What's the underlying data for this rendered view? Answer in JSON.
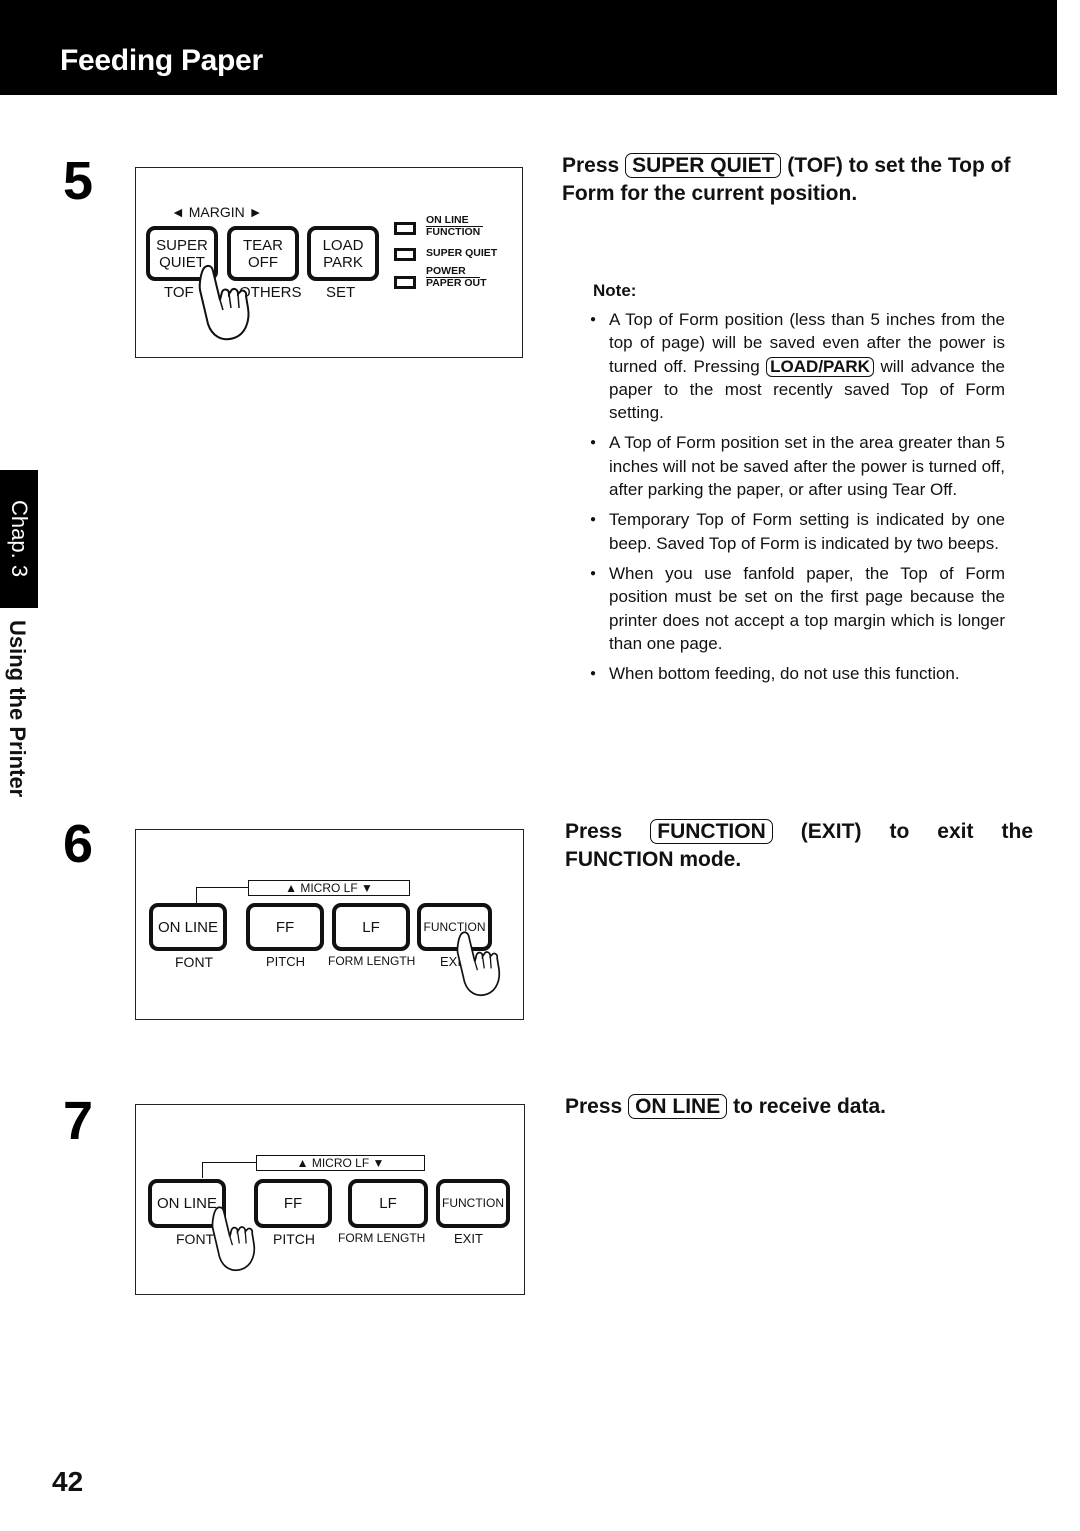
{
  "header": {
    "title": "Feeding Paper"
  },
  "side_tab": {
    "chapter": "Chap. 3",
    "section": "Using the Printer"
  },
  "page_number": "42",
  "steps": [
    {
      "number": "5",
      "panel": {
        "margin_label": "◄ MARGIN ►",
        "buttons": [
          {
            "line1": "SUPER",
            "line2": "QUIET",
            "sub": "TOF"
          },
          {
            "line1": "TEAR",
            "line2": "OFF",
            "sub": "OTHERS"
          },
          {
            "line1": "LOAD",
            "line2": "PARK",
            "sub": "SET"
          }
        ],
        "indicators": [
          {
            "top": "ON LINE",
            "bottom": "FUNCTION"
          },
          {
            "top": "SUPER QUIET",
            "bottom": ""
          },
          {
            "top": "POWER",
            "bottom": "PAPER OUT"
          }
        ],
        "pressed": "SUPER QUIET"
      },
      "instruction": {
        "prefix": "Press",
        "key": "SUPER QUIET",
        "suffix": "(TOF) to set the Top of Form for the current position."
      },
      "note": {
        "title": "Note:",
        "items": [
          {
            "before": "A Top of Form position (less than 5 inches from the top of page) will be saved even after the power is turned off. Pressing ",
            "key": "LOAD/PARK",
            "after": " will advance the paper to the most recently saved Top of Form setting."
          },
          {
            "before": "A Top of Form position set in the area greater than 5 inches will not be saved after the power is turned off, after parking the paper, or after using Tear Off.",
            "key": "",
            "after": ""
          },
          {
            "before": "Temporary Top of Form setting is indicated by one beep. Saved Top of Form is indicated by two beeps.",
            "key": "",
            "after": ""
          },
          {
            "before": "When you use fanfold paper, the Top of Form position must be set on the first page because the printer does not accept a top margin which is longer than one page.",
            "key": "",
            "after": ""
          },
          {
            "before": "When bottom feeding, do not use this function.",
            "key": "",
            "after": ""
          }
        ]
      }
    },
    {
      "number": "6",
      "panel": {
        "micro_lf": "▲ MICRO LF ▼",
        "buttons": [
          {
            "label": "ON LINE",
            "sub": "FONT"
          },
          {
            "label": "FF",
            "sub": "PITCH"
          },
          {
            "label": "LF",
            "sub": "FORM LENGTH"
          },
          {
            "label": "FUNCTION",
            "sub": "EXIT"
          }
        ],
        "pressed": "FUNCTION"
      },
      "instruction": {
        "prefix": "Press",
        "key": "FUNCTION",
        "suffix": "(EXIT) to exit the FUNCTION mode."
      }
    },
    {
      "number": "7",
      "panel": {
        "micro_lf": "▲ MICRO LF ▼",
        "buttons": [
          {
            "label": "ON LINE",
            "sub": "FONT"
          },
          {
            "label": "FF",
            "sub": "PITCH"
          },
          {
            "label": "LF",
            "sub": "FORM LENGTH"
          },
          {
            "label": "FUNCTION",
            "sub": "EXIT"
          }
        ],
        "pressed": "ON LINE"
      },
      "instruction": {
        "prefix": "Press",
        "key": "ON LINE",
        "suffix": "to receive data."
      }
    }
  ]
}
